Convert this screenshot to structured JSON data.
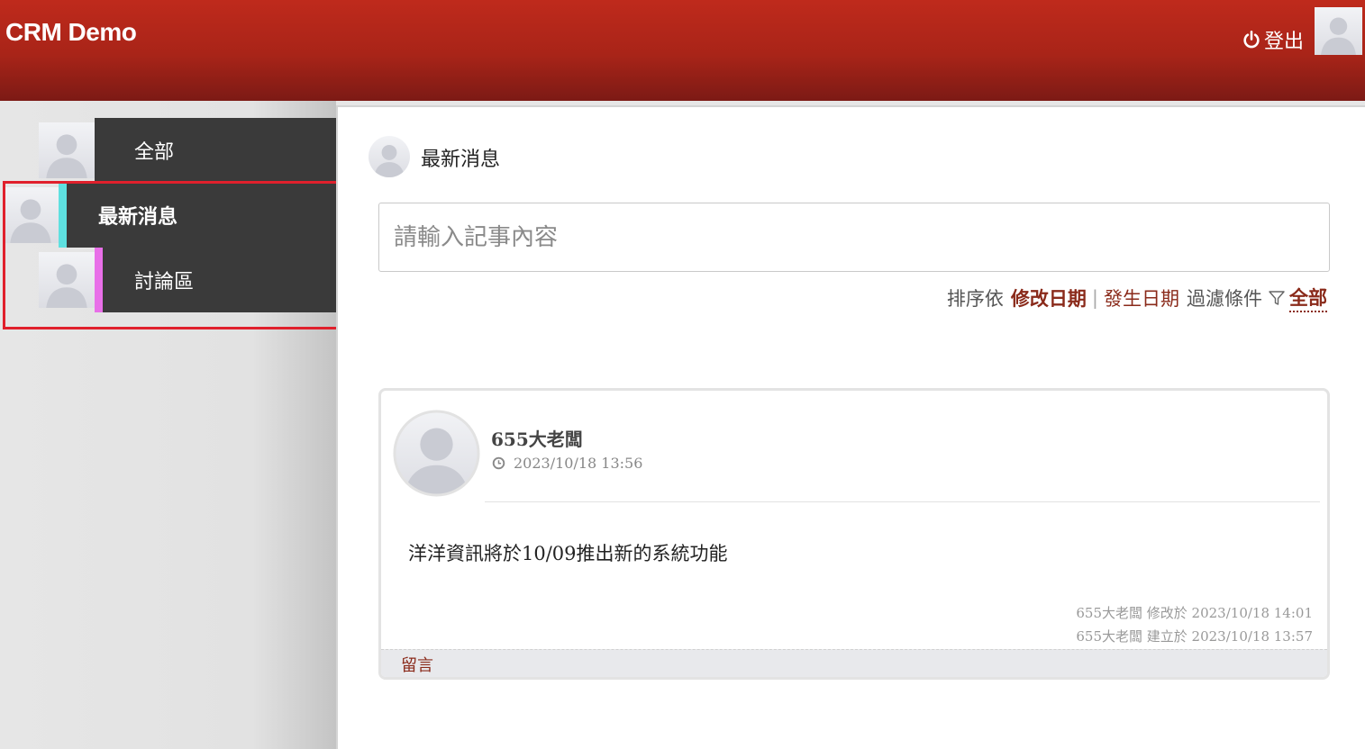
{
  "header": {
    "app_title": "CRM Demo",
    "logout_label": "登出",
    "logout_icon": "power-icon",
    "avatar_icon": "user-avatar-icon"
  },
  "sidebar": {
    "items": [
      {
        "label": "全部",
        "stripe_color": "#3a3a3a",
        "active": false
      },
      {
        "label": "最新消息",
        "stripe_color": "#5ee0e0",
        "active": true
      },
      {
        "label": "討論區",
        "stripe_color": "#e86fe8",
        "active": false
      }
    ]
  },
  "main": {
    "title": "最新消息",
    "input_placeholder": "請輸入記事內容",
    "sort": {
      "prefix": "排序依",
      "option_modified": "修改日期",
      "separator": "|",
      "option_occurred": "發生日期",
      "filter_label": "過濾條件",
      "filter_value": "全部",
      "filter_icon": "funnel-icon"
    },
    "posts": [
      {
        "author": "655大老闆",
        "timestamp": "2023/10/18 13:56",
        "body": "洋洋資訊將於10/09推出新的系統功能",
        "modified_meta": "655大老闆 修改於 2023/10/18 14:01",
        "created_meta": "655大老闆 建立於 2023/10/18 13:57",
        "comment_label": "留言"
      }
    ]
  },
  "colors": {
    "brand_red": "#bf2a1c",
    "link_red": "#8a2a1a",
    "nav_dark": "#3a3a3a",
    "highlight": "#e0202c"
  }
}
